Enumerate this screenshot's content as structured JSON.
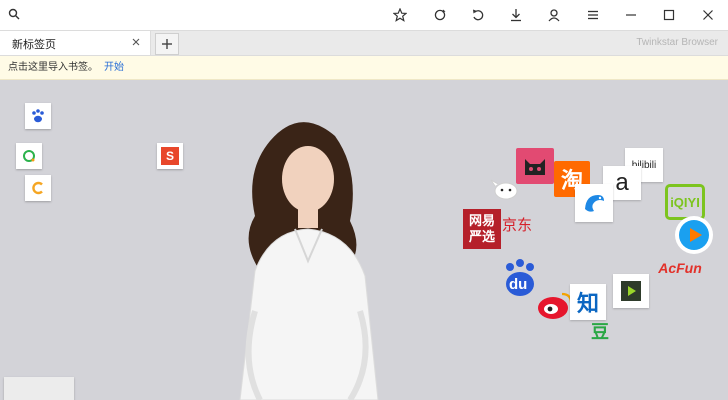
{
  "toolbar": {
    "address_value": "",
    "icons": [
      "search-icon",
      "star-icon",
      "refresh-icon",
      "undo-icon",
      "download-icon",
      "user-icon",
      "menu-icon",
      "minimize-icon",
      "maximize-icon",
      "close-icon"
    ]
  },
  "tabs": {
    "active_label": "新标签页",
    "brand": "Twinkstar Browser"
  },
  "notification": {
    "text": "点击这里导入书签。",
    "link": "开始"
  },
  "tiles": {
    "netease_line1": "网易",
    "netease_line2": "严选",
    "jd": "京东",
    "taobao": "淘",
    "bilibili": "bilibili",
    "zhihu": "知",
    "douban": "豆",
    "acfun": "AcFun",
    "iqiyi": "iQIYI",
    "sohu": "S",
    "baidu": "du",
    "amazon": "a"
  },
  "colors": {
    "accent": "#2a6fd6",
    "notify_bg": "#fffbe6",
    "content_bg": "#d3d3d8"
  }
}
